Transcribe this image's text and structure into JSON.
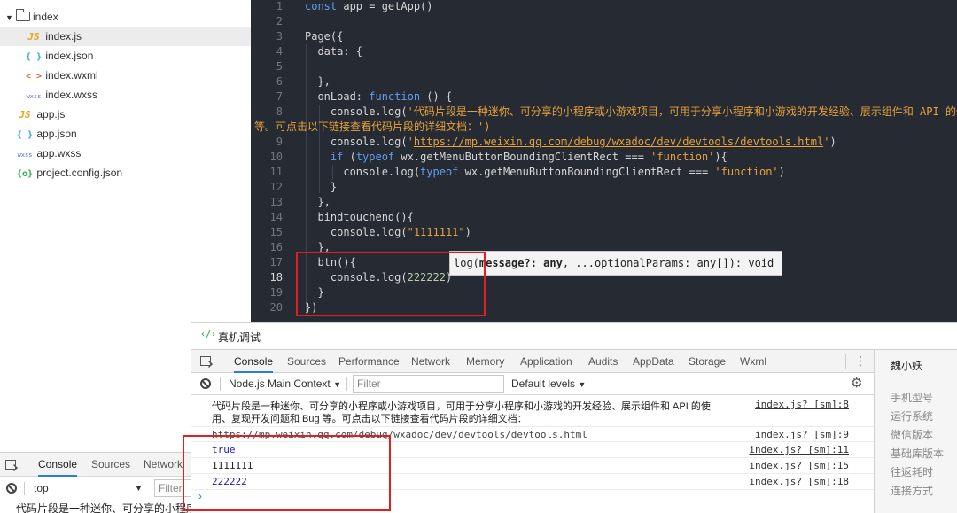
{
  "file_tree": {
    "folder": "index",
    "index_files": [
      {
        "icon": "JS",
        "name": "index.js"
      },
      {
        "icon": "{ }",
        "name": "index.json"
      },
      {
        "icon": "< >",
        "name": "index.wxml"
      },
      {
        "icon": "wxss",
        "name": "index.wxss"
      }
    ],
    "root_files": [
      {
        "icon": "JS",
        "name": "app.js"
      },
      {
        "icon": "{ }",
        "name": "app.json"
      },
      {
        "icon": "wxss",
        "name": "app.wxss"
      },
      {
        "icon": "{o}",
        "name": "project.config.json"
      }
    ]
  },
  "editor": {
    "line_numbers": [
      "1",
      "2",
      "3",
      "4",
      "5",
      "6",
      "7",
      "8",
      "",
      "9",
      "10",
      "11",
      "12",
      "13",
      "14",
      "15",
      "16",
      "17",
      "18",
      "19",
      "20"
    ],
    "active_line": "18",
    "code": {
      "l1_kw": "const",
      "l1_rest": " app = getApp()",
      "l3": "Page({",
      "l4": "  data: {",
      "l6": "  },",
      "l7_a": "  onLoad: ",
      "l7_kw": "function",
      "l7_b": " () {",
      "l8_a": "    console.log(",
      "l8_str": "'代码片段是一种迷你、可分享的小程序或小游戏项目，可用于分享小程序和小游戏的开发经验、展示组件和 API 的使用、复现开发问题和 Bug",
      "l8_wrap": "等。可点击以下链接查看代码片段的详细文档：')",
      "l9_a": "    console.log(",
      "l9_q1": "'",
      "l9_url": "https://mp.weixin.qq.com/debug/wxadoc/dev/devtools/devtools.html",
      "l9_q2": "'",
      "l9_b": ")",
      "l10_a": "    ",
      "l10_kw1": "if",
      "l10_b": " (",
      "l10_kw2": "typeof",
      "l10_c": " wx.getMenuButtonBoundingClientRect === ",
      "l10_str": "'function'",
      "l10_d": "){",
      "l11_a": "      console.log(",
      "l11_kw": "typeof",
      "l11_b": " wx.getMenuButtonBoundingClientRect === ",
      "l11_str": "'function'",
      "l11_c": ")",
      "l12": "    }",
      "l13": "  },",
      "l14": "  bindtouchend(){",
      "l15_a": "    console.log(",
      "l15_str": "\"1111111\"",
      "l15_b": ")",
      "l16": "  },",
      "l17": "  btn(){",
      "l18_a": "    console.log(",
      "l18_num": "222222",
      "l18_b": ")",
      "l19": "  }",
      "l20": "})"
    },
    "hint": {
      "prefix": "log(",
      "param": "message?: any",
      "suffix": ", ...optionalParams: any[]): void"
    }
  },
  "left_devtools": {
    "tabs": [
      "Console",
      "Sources",
      "Network"
    ],
    "context": "top",
    "filter_placeholder": "Filter",
    "log_preview": "代码片段是一种迷你、可分享的小程序"
  },
  "remote_debug": {
    "icon": "‹/›",
    "title": "真机调试",
    "tabs": [
      "Console",
      "Sources",
      "Performance",
      "Network",
      "Memory",
      "Application",
      "Audits",
      "AppData",
      "Storage",
      "Wxml"
    ],
    "context": "Node.js Main Context",
    "filter_placeholder": "Filter",
    "levels": "Default levels",
    "logs": [
      {
        "msg1": "代码片段是一种迷你、可分享的小程序或小游戏项目，可用于分享小程序和小游戏的开发经验、展示组件和 API 的使",
        "msg2": "用、复现开发问题和 Bug 等。可点击以下链接查看代码片段的详细文档：",
        "src": "index.js? [sm]:8"
      },
      {
        "msg": "https://mp.weixin.qq.com/debug/wxadoc/dev/devtools/devtools.html",
        "src": "index.js? [sm]:9"
      },
      {
        "msg": "true",
        "src": "index.js? [sm]:11"
      },
      {
        "msg": "1111111",
        "src": "index.js? [sm]:15"
      },
      {
        "msg": "222222",
        "src": "index.js? [sm]:18"
      }
    ],
    "prompt": "›",
    "device": {
      "name": "魏小妖",
      "fields": [
        "手机型号",
        "运行系统",
        "微信版本",
        "基础库版本",
        "往返耗时",
        "连接方式"
      ]
    }
  }
}
